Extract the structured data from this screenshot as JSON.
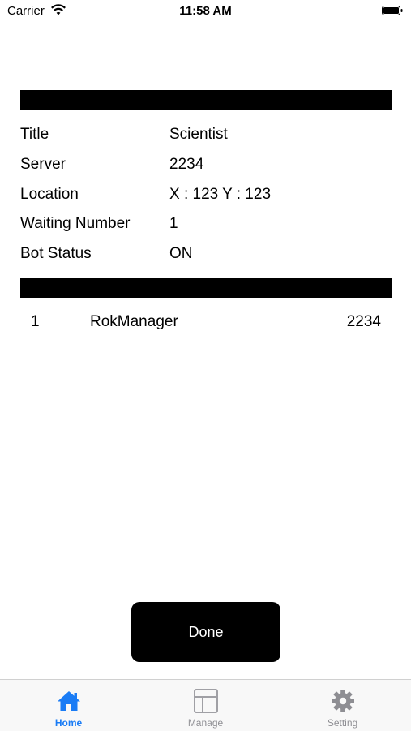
{
  "status_bar": {
    "carrier": "Carrier",
    "time": "11:58 AM"
  },
  "info": [
    {
      "label": "Title",
      "value": "Scientist"
    },
    {
      "label": "Server",
      "value": "2234"
    },
    {
      "label": "Location",
      "value": "X : 123 Y : 123"
    },
    {
      "label": "Waiting Number",
      "value": "1"
    },
    {
      "label": "Bot Status",
      "value": "ON"
    }
  ],
  "list": [
    {
      "rank": "1",
      "name": "RokManager",
      "server": "2234"
    }
  ],
  "done_label": "Done",
  "tabs": [
    {
      "label": "Home",
      "icon": "house-icon",
      "active": true
    },
    {
      "label": "Manage",
      "icon": "layout-icon",
      "active": false
    },
    {
      "label": "Setting",
      "icon": "gear-icon",
      "active": false
    }
  ],
  "colors": {
    "accent": "#1a7cf5",
    "inactive": "#8e8e93",
    "button": "#000000"
  }
}
